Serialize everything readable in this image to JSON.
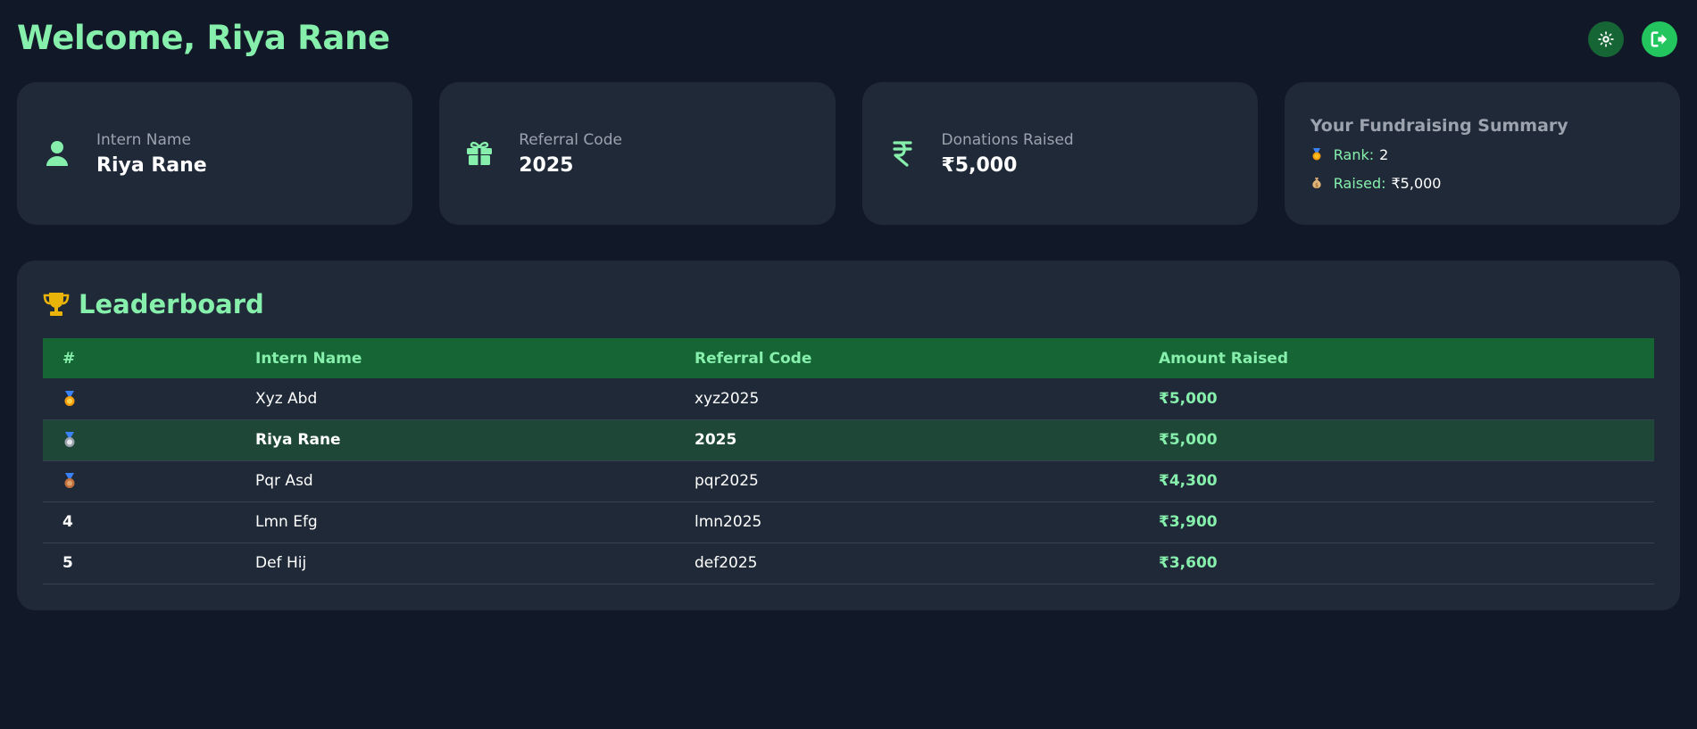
{
  "header": {
    "title": "Welcome, Riya Rane",
    "theme_button_icon": "sun-icon",
    "logout_button_icon": "logout-icon"
  },
  "cards": {
    "intern": {
      "label": "Intern Name",
      "value": "Riya Rane",
      "icon": "user-icon"
    },
    "referral": {
      "label": "Referral Code",
      "value": "2025",
      "icon": "gift-icon"
    },
    "donations": {
      "label": "Donations Raised",
      "value": "₹5,000",
      "icon": "rupee-icon"
    }
  },
  "summary": {
    "title": "Your Fundraising Summary",
    "rank_label": "Rank:",
    "rank_value": "2",
    "raised_label": "Raised:",
    "raised_value": "₹5,000"
  },
  "leaderboard": {
    "title": "Leaderboard",
    "headers": [
      "#",
      "Intern Name",
      "Referral Code",
      "Amount Raised"
    ],
    "rows": [
      {
        "rank": "",
        "medal": "gold",
        "name": "Xyz Abd",
        "code": "xyz2025",
        "amount": "₹5,000",
        "highlight": false
      },
      {
        "rank": "",
        "medal": "silver",
        "name": "Riya Rane",
        "code": "2025",
        "amount": "₹5,000",
        "highlight": true
      },
      {
        "rank": "",
        "medal": "bronze",
        "name": "Pqr Asd",
        "code": "pqr2025",
        "amount": "₹4,300",
        "highlight": false
      },
      {
        "rank": "4",
        "medal": "",
        "name": "Lmn Efg",
        "code": "lmn2025",
        "amount": "₹3,900",
        "highlight": false
      },
      {
        "rank": "5",
        "medal": "",
        "name": "Def Hij",
        "code": "def2025",
        "amount": "₹3,600",
        "highlight": false
      }
    ]
  },
  "colors": {
    "background": "#111827",
    "card": "#1f2937",
    "accent": "#86efac",
    "header_row": "#166534",
    "highlight_row": "#1e4737",
    "logout_button": "#22c55e"
  }
}
